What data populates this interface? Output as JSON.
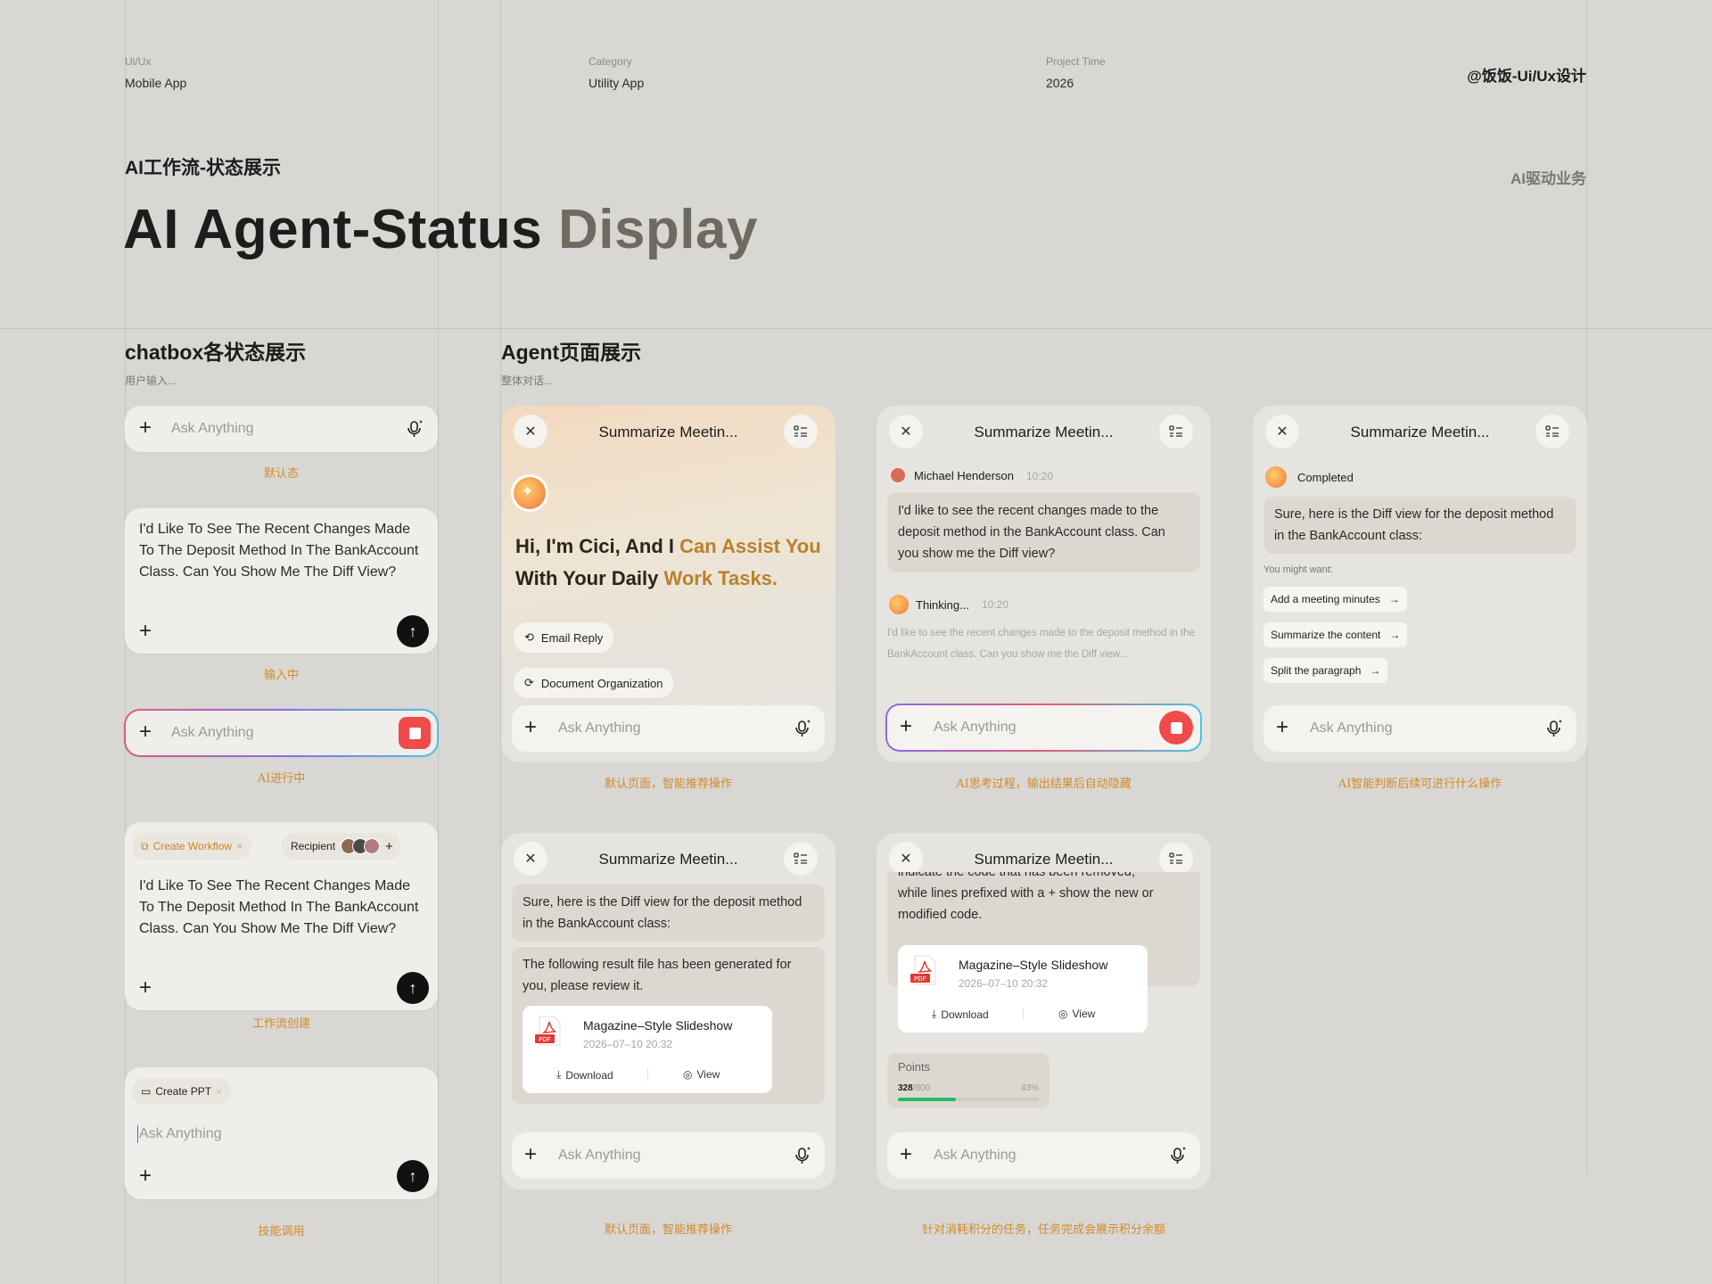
{
  "header": {
    "uiux_label": "Ui/Ux",
    "uiux_value": "Mobile App",
    "category_label": "Category",
    "category_value": "Utility App",
    "time_label": "Project Time",
    "time_value": "2026",
    "author": "@饭饭-Ui/Ux设计",
    "subtitle_cn": "AI工作流-状态展示",
    "title_dark": "AI Agent-Status ",
    "title_light": "Display",
    "right_tag": "AI驱动业务"
  },
  "left_section": {
    "title": "chatbox各状态展示",
    "subtitle": "用户输入...",
    "placeholder": "Ask Anything",
    "typed_text": "I'd Like To See The Recent Changes Made To The Deposit Method In The BankAccount Class. Can You Show Me The Diff View?",
    "captions": [
      "默认态",
      "输入中",
      "AI进行中",
      "工作流创建",
      "技能调用"
    ],
    "workflow_chip": "Create Workflow",
    "recipient_label": "Recipient",
    "ppt_chip": "Create PPT"
  },
  "right_section": {
    "title": "Agent页面展示",
    "subtitle": "整体对话...",
    "phone_title": "Summarize Meetin...",
    "placeholder": "Ask Anything",
    "greeting_dark1": "Hi, I'm Cici, And I ",
    "greeting_gold1": "Can Assist You",
    "greeting_dark2": "With Your Daily ",
    "greeting_gold2": "Work Tasks.",
    "chip_email": "Email Reply",
    "chip_doc": "Document Organization",
    "user_name": "Michael Henderson",
    "user_time": "10:20",
    "user_msg": "I'd like to see the recent changes made to the deposit method in the BankAccount class. Can you show me the Diff view?",
    "thinking_label": "Thinking...",
    "thinking_time": "10:20",
    "thinking_text": "I'd like to see the recent changes made to the deposit method in the BankAccount class. Can you show me the Diff view...",
    "completed_label": "Completed",
    "reply": "Sure, here is the Diff view for the deposit method in the BankAccount class:",
    "might_want": "You might want:",
    "sugg1": "Add a meeting minutes",
    "sugg2": "Summarize the content",
    "sugg3": "Split the paragraph",
    "result_text": "The following result file has been generated for you, please review it.",
    "file_name": "Magazine–Style Slideshow",
    "file_date": "2026–07–10 20:32",
    "download": "Download",
    "view": "View",
    "cut_text_top": "indicate the code that has been removed,",
    "cut_text": "while lines prefixed with a + show the new or modified code.",
    "points_label": "Points",
    "points_used": "328",
    "points_total": "/800",
    "points_pct": "43%",
    "points_value": 0.41,
    "captions": [
      "默认页面，智能推荐操作",
      "AI思考过程，输出结果后自动隐藏",
      "AI智能判断后续可进行什么操作",
      "默认页面，智能推荐操作",
      "针对消耗积分的任务，任务完成会展示积分余额"
    ],
    "pdf_tag": "PDF"
  },
  "colors": {
    "gold": "#b8822a",
    "accent_red": "#f04a4a",
    "caption": "#d38a2a",
    "progress": "#27b868"
  }
}
